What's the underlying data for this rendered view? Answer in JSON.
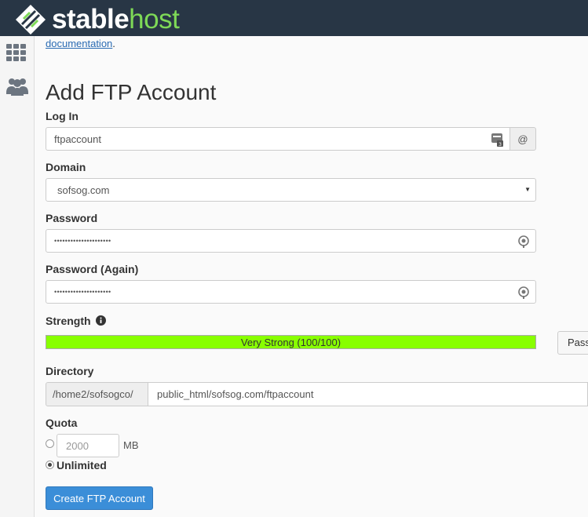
{
  "brand": {
    "name_part1": "stable",
    "name_part2": "host"
  },
  "sidebar": {
    "items": [
      {
        "icon": "grid-icon"
      },
      {
        "icon": "users-icon"
      }
    ]
  },
  "intro": {
    "link_text": "documentation",
    "suffix": "."
  },
  "page": {
    "title": "Add FTP Account"
  },
  "form": {
    "login": {
      "label": "Log In",
      "value": "ftpaccount",
      "addon": "@"
    },
    "domain": {
      "label": "Domain",
      "value": "sofsog.com"
    },
    "password": {
      "label": "Password",
      "value": "•••••••••••••••••••••"
    },
    "password_again": {
      "label": "Password (Again)",
      "value": "•••••••••••••••••••••"
    },
    "strength": {
      "label": "Strength",
      "bar_text": "Very Strong (100/100)",
      "score": 100,
      "bar_color": "#88ff00",
      "generator_label": "Password Generator"
    },
    "directory": {
      "label": "Directory",
      "prefix": "/home2/sofsogco/",
      "value": "public_html/sofsog.com/ftpaccount"
    },
    "quota": {
      "label": "Quota",
      "value": "2000",
      "unit": "MB",
      "unlimited_label": "Unlimited",
      "selected": "unlimited"
    },
    "submit_label": "Create FTP Account"
  },
  "colors": {
    "topbar": "#283645",
    "accent": "#3b8ed8",
    "brand_green": "#7ed957"
  }
}
